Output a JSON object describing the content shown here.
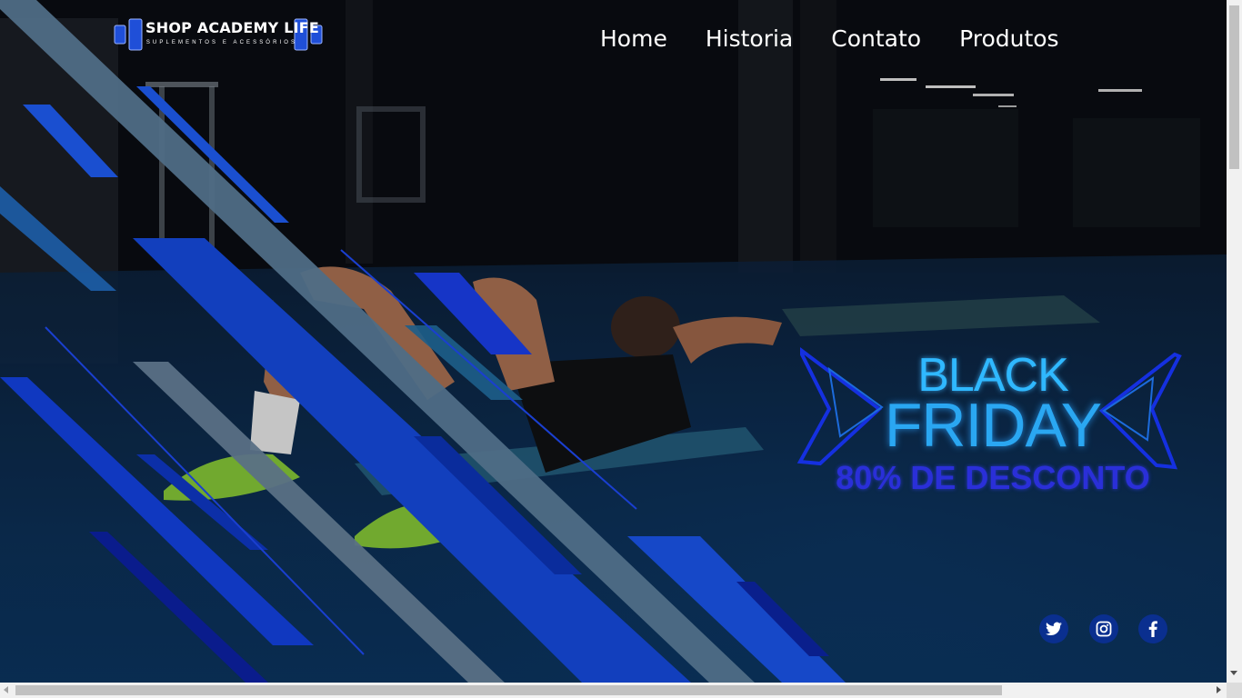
{
  "brand": {
    "title": "SHOP ACADEMY LIFE",
    "subtitle": "SUPLEMENTOS E ACESSÓRIOS",
    "accent": "#1f4fd8"
  },
  "nav": {
    "items": [
      {
        "label": "Home"
      },
      {
        "label": "Historia"
      },
      {
        "label": "Contato"
      },
      {
        "label": "Produtos"
      }
    ]
  },
  "promo": {
    "line1": "BLACK",
    "line2": "FRIDAY",
    "line3": "80% DE DESCONTO",
    "neon_color": "#2aa7f2",
    "discount_color": "#2a2fd8"
  },
  "hero_image": {
    "icon": "man-doing-situps-in-gym-photo"
  },
  "social": {
    "items": [
      {
        "icon": "twitter-icon"
      },
      {
        "icon": "instagram-icon"
      },
      {
        "icon": "facebook-icon"
      }
    ],
    "color": "#0a2f8f"
  }
}
